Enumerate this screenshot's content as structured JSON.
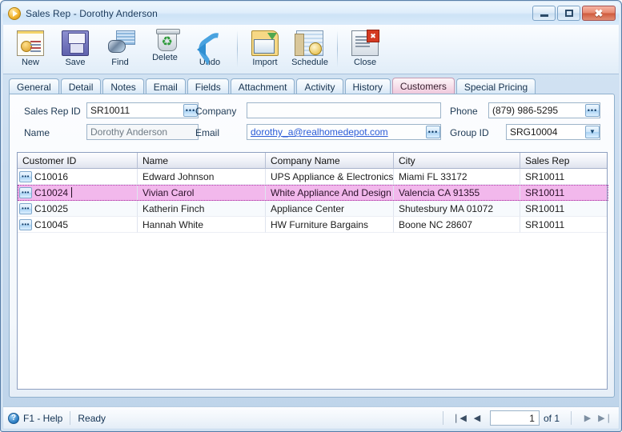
{
  "window": {
    "title": "Sales Rep - Dorothy Anderson",
    "app_icon": "play-circle-icon",
    "minimize_label": "–",
    "maximize_label": "□",
    "close_label": "✖"
  },
  "toolbar": {
    "buttons": [
      {
        "label": "New",
        "icon": "new-record-icon"
      },
      {
        "label": "Save",
        "icon": "floppy-disk-icon"
      },
      {
        "label": "Find",
        "icon": "binoculars-icon"
      },
      {
        "label": "Delete",
        "icon": "trash-recycle-icon"
      },
      {
        "label": "Undo",
        "icon": "undo-arrow-icon"
      },
      {
        "label": "Import",
        "icon": "import-folder-icon"
      },
      {
        "label": "Schedule",
        "icon": "schedule-clock-icon"
      },
      {
        "label": "Close",
        "icon": "close-document-icon"
      }
    ]
  },
  "tabs": [
    {
      "label": "General",
      "active": false
    },
    {
      "label": "Detail",
      "active": false
    },
    {
      "label": "Notes",
      "active": false
    },
    {
      "label": "Email",
      "active": false
    },
    {
      "label": "Fields",
      "active": false
    },
    {
      "label": "Attachment",
      "active": false
    },
    {
      "label": "Activity",
      "active": false
    },
    {
      "label": "History",
      "active": false
    },
    {
      "label": "Customers",
      "active": true
    },
    {
      "label": "Special Pricing",
      "active": false
    }
  ],
  "form": {
    "sales_rep_id": {
      "label": "Sales Rep ID",
      "value": "SR10011",
      "button": "ellipsis-icon"
    },
    "name": {
      "label": "Name",
      "value": "Dorothy Anderson",
      "readonly": true
    },
    "company": {
      "label": "Company",
      "value": ""
    },
    "email": {
      "label": "Email",
      "value": "dorothy_a@realhomedepot.com",
      "button": "ellipsis-icon"
    },
    "phone": {
      "label": "Phone",
      "value": "(879) 986-5295",
      "button": "ellipsis-icon"
    },
    "group_id": {
      "label": "Group ID",
      "value": "SRG10004",
      "button": "chevron-down-icon"
    }
  },
  "grid": {
    "columns": [
      "Customer ID",
      "Name",
      "Company Name",
      "City",
      "Sales Rep"
    ],
    "rows": [
      {
        "customer_id": "C10016",
        "name": "Edward Johnson",
        "company": "UPS Appliance & Electronics",
        "city": "Miami FL 33172",
        "sales_rep": "SR10011",
        "selected": false,
        "editing": false
      },
      {
        "customer_id": "C10024",
        "name": "Vivian Carol",
        "company": "White Appliance And Design Cen",
        "city": "Valencia CA 91355",
        "sales_rep": "SR10011",
        "selected": true,
        "editing": true
      },
      {
        "customer_id": "C10025",
        "name": "Katherin Finch",
        "company": "Appliance Center",
        "city": "Shutesbury MA 01072",
        "sales_rep": "SR10011",
        "selected": false,
        "editing": false
      },
      {
        "customer_id": "C10045",
        "name": "Hannah White",
        "company": "HW Furniture Bargains",
        "city": "Boone NC 28607",
        "sales_rep": "SR10011",
        "selected": false,
        "editing": false
      }
    ],
    "row_button_label": "•••",
    "selection_color": "#f2b8ec"
  },
  "statusbar": {
    "help_icon": "question-help-icon",
    "help_label": "F1 - Help",
    "status_label": "Ready",
    "nav": {
      "first_label": "❘◀",
      "prev_label": "◀",
      "page_value": "1",
      "of_label": "of 1",
      "next_label": "▶",
      "last_label": "▶❘"
    }
  },
  "colors": {
    "accent": "#2a5bd7",
    "active_tab": "#eec4da",
    "selected_row": "#f2b8ec",
    "close_button": "#cf5a3c"
  }
}
